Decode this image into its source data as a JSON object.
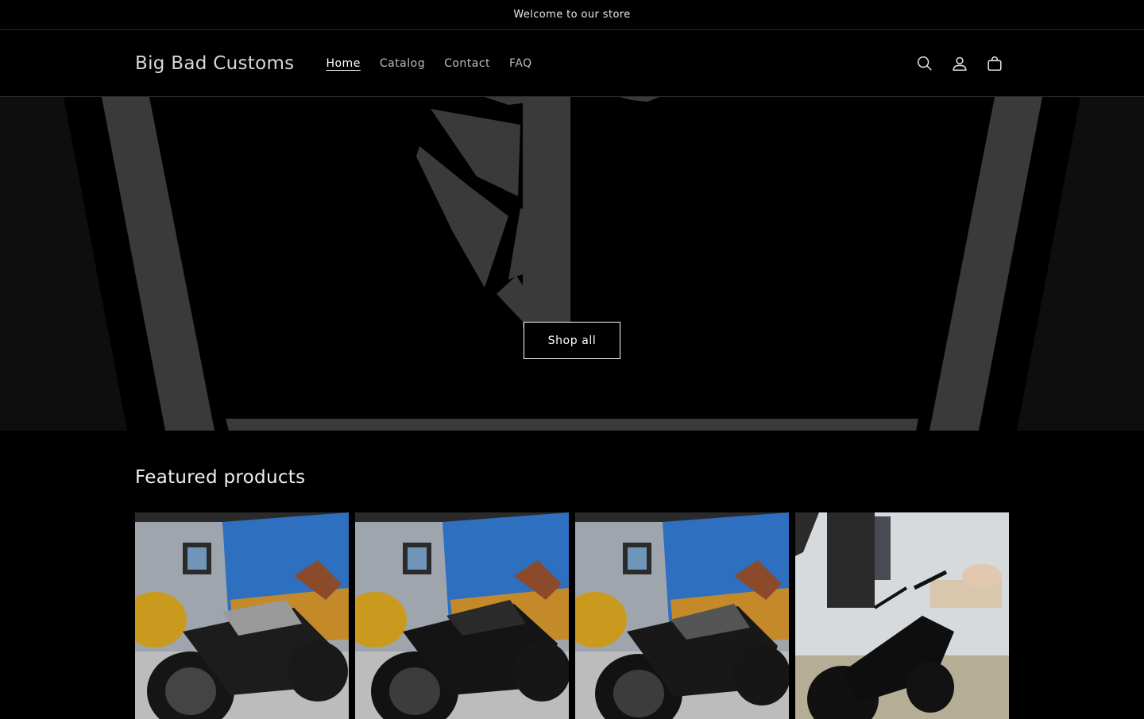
{
  "announcement": {
    "text": "Welcome to our store"
  },
  "header": {
    "logo": "Big Bad Customs",
    "nav": [
      {
        "label": "Home",
        "active": true
      },
      {
        "label": "Catalog",
        "active": false
      },
      {
        "label": "Contact",
        "active": false
      },
      {
        "label": "FAQ",
        "active": false
      }
    ],
    "icons": [
      "search-icon",
      "account-icon",
      "cart-icon"
    ]
  },
  "hero": {
    "button_label": "Shop all"
  },
  "featured": {
    "title": "Featured products",
    "products": [
      {
        "image": "motorcycle-silver-showroom"
      },
      {
        "image": "motorcycle-black-showroom"
      },
      {
        "image": "motorcycle-dark-showroom"
      },
      {
        "image": "motorcycle-black-studio"
      }
    ]
  },
  "colors": {
    "background": "#000000",
    "text": "#ffffff",
    "hero_shape": "#3a3a3a"
  }
}
